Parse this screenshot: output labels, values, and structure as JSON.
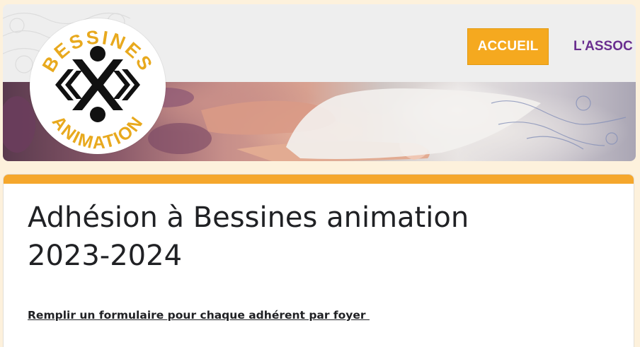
{
  "header": {
    "logo": {
      "text_top": "BESSINES",
      "text_bottom": "ANIMATION",
      "colors": {
        "gold": "#e8a91e",
        "black": "#111111"
      }
    },
    "nav": {
      "active_label": "ACCUEIL",
      "next_label": "L'ASSOC",
      "active_bg": "#f5a91f",
      "next_color": "#6a2e8f"
    }
  },
  "form": {
    "accent_color": "#f5a72c",
    "title_line1": "Adhésion à Bessines animation",
    "title_line2": "2023-2024",
    "subtitle": "Remplir un formulaire pour chaque adhérent par foyer "
  }
}
